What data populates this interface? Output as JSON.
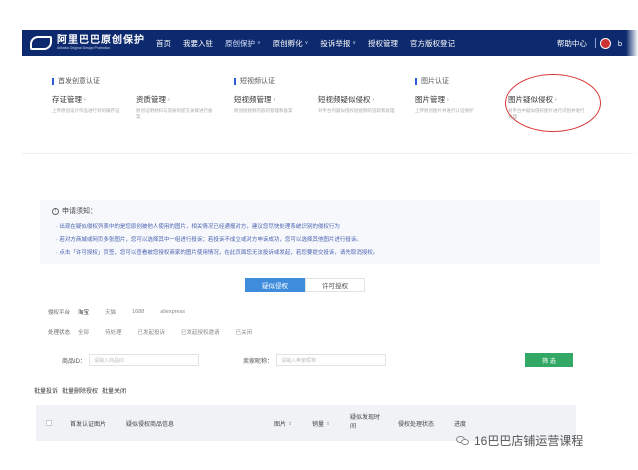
{
  "header": {
    "logo_cn": "阿里巴巴原创保护",
    "logo_en": "Alibaba Original Design Protection",
    "nav": [
      {
        "label": "首页",
        "has_chevron": false
      },
      {
        "label": "我要入驻",
        "has_chevron": false
      },
      {
        "label": "原创保护",
        "has_chevron": true
      },
      {
        "label": "原创孵化",
        "has_chevron": true
      },
      {
        "label": "投诉举报",
        "has_chevron": true
      },
      {
        "label": "授权管理",
        "has_chevron": false
      },
      {
        "label": "官方版权登记",
        "has_chevron": false
      }
    ],
    "help": "帮助中心",
    "user": "b"
  },
  "mega": {
    "groups": [
      {
        "title": "首发创意认证"
      },
      {
        "title": "短视频认证"
      },
      {
        "title": "图片认证"
      }
    ],
    "items": [
      {
        "title": "存证管理",
        "desc": "上传原创设计作品进行对的确存证"
      },
      {
        "title": "资质管理",
        "desc": "原创证明材料与资质的提交关联进行备案"
      },
      {
        "title": "短视频管理",
        "desc": "原创短视频内容的管理和备案"
      },
      {
        "title": "短视频疑似侵权",
        "desc": "对平台内疑似侵权短视频的追踪和处理"
      },
      {
        "title": "图片管理",
        "desc": "上传原创图片并进行认证保护"
      },
      {
        "title": "图片疑似侵权",
        "desc": "对平台中疑似侵权图片进行识别并进行处理"
      }
    ]
  },
  "notice": {
    "title": "申请须知：",
    "lines": [
      "· 出现在疑似侵权列表中的是您原创被他人使用的图片，相关情况已经通报对方，建议您尽快处理系统识别的侵权行为",
      "· 若对方商城或网页多张图片，您可以选择其中一组进行投诉；若投诉不成立或对方申诉成功，您可以选择其他图片进行投诉。",
      "· 点击「许可授权」页签，您可以查看被您授权商家的图片使用情况，在此页面您无法投诉或发起，若您要提交投诉，请先取消授权。"
    ]
  },
  "tabs": {
    "active": "疑似侵权",
    "other": "许可授权"
  },
  "filters": {
    "platform_label": "侵权平台",
    "platforms": [
      "淘宝",
      "天猫",
      "1688",
      "aliexpress"
    ],
    "status_label": "处理状态",
    "statuses": [
      "全部",
      "待处理",
      "已发起投诉",
      "已发起授权邀请",
      "已关闭"
    ]
  },
  "search": {
    "product_label": "商品ID：",
    "product_placeholder": "请输入商品ID",
    "seller_label": "卖家昵称：",
    "seller_placeholder": "请输入卖家昵称",
    "button": "筛 选"
  },
  "batch": [
    "批量投诉",
    "批量删除授权",
    "批量关闭"
  ],
  "table": {
    "columns": [
      "首发认证图片",
      "疑似侵权商品信息",
      "图片",
      "销量",
      "疑似发现时间",
      "侵权处理状态",
      "进度"
    ]
  },
  "watermark": "16巴巴店铺运营课程",
  "colors": {
    "header_bg": "#0d2a6e",
    "accent": "#3f8cdc",
    "green": "#32a864",
    "annotation": "#d93a3a"
  }
}
